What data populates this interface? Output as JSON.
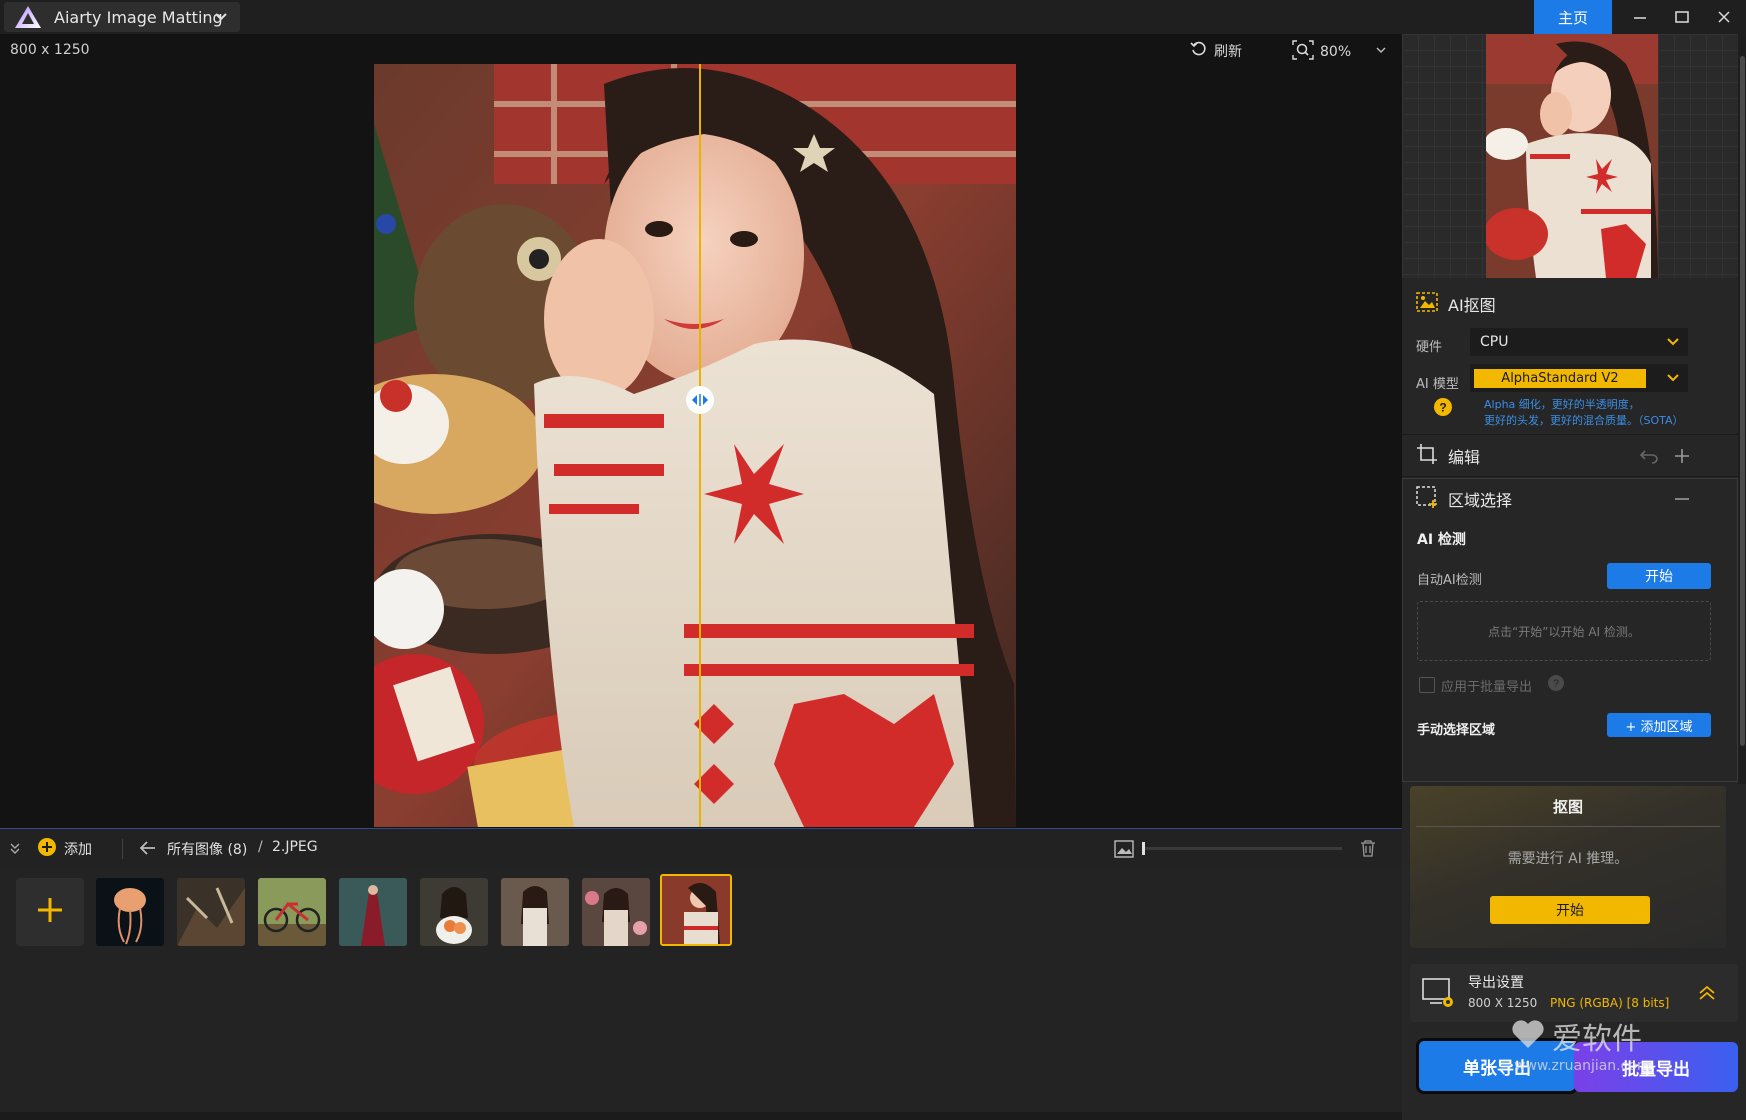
{
  "titlebar": {
    "app_name": "Aiarty Image Matting",
    "home_label": "主页"
  },
  "viewer": {
    "dimensions": "800 x 1250",
    "refresh_label": "刷新",
    "zoom_level": "80%"
  },
  "gallery_bar": {
    "add_label": "添加",
    "all_images_label": "所有图像 (8)",
    "separator": "/",
    "current_file": "2.JPEG"
  },
  "gallery": {
    "thumbnails": [
      {
        "name": "jellyfish",
        "color": "#0b1a22"
      },
      {
        "name": "forest-creature",
        "color": "#4a3a2a"
      },
      {
        "name": "bicycle",
        "color": "#7a8a4a"
      },
      {
        "name": "red-dress-forest",
        "color": "#2f4a4a"
      },
      {
        "name": "girl-flowers",
        "color": "#4a3a30"
      },
      {
        "name": "girl-lace",
        "color": "#5a4e44"
      },
      {
        "name": "girl-roses",
        "color": "#5e4c44"
      },
      {
        "name": "girl-christmas",
        "color": "#8a3a2a"
      }
    ],
    "selected_index": 7
  },
  "right_panel": {
    "ai_matting": {
      "title": "AI抠图",
      "hardware_label": "硬件",
      "hardware_value": "CPU",
      "model_label": "AI 模型",
      "model_value": "AlphaStandard  V2",
      "model_desc_line1": "Alpha 细化，更好的半透明度，",
      "model_desc_line2": "更好的头发，更好的混合质量。（SOTA）"
    },
    "edit": {
      "title": "编辑"
    },
    "region": {
      "title": "区域选择",
      "ai_detect_heading": "AI 检测",
      "auto_detect_label": "自动AI检测",
      "start_label": "开始",
      "hint": "点击“开始”以开始 AI 检测。",
      "apply_batch_label": "应用于批量导出",
      "manual_heading": "手动选择区域",
      "add_region_label": "+ 添加区域"
    },
    "matting_card": {
      "title": "抠图",
      "message": "需要进行 AI 推理。",
      "start_label": "开始"
    },
    "export_settings": {
      "title": "导出设置",
      "size": "800 X 1250",
      "format": "PNG (RGBA) [8 bits]"
    },
    "export_buttons": {
      "single": "单张导出",
      "batch": "批量导出"
    },
    "watermark": {
      "brand": "爱软件",
      "url": "www.zruanjian.com"
    }
  },
  "colors": {
    "accent_blue": "#1d7be8",
    "accent_yellow": "#f2b800",
    "format_text": "#f2b800",
    "model_desc_text": "#3a8ee6"
  }
}
